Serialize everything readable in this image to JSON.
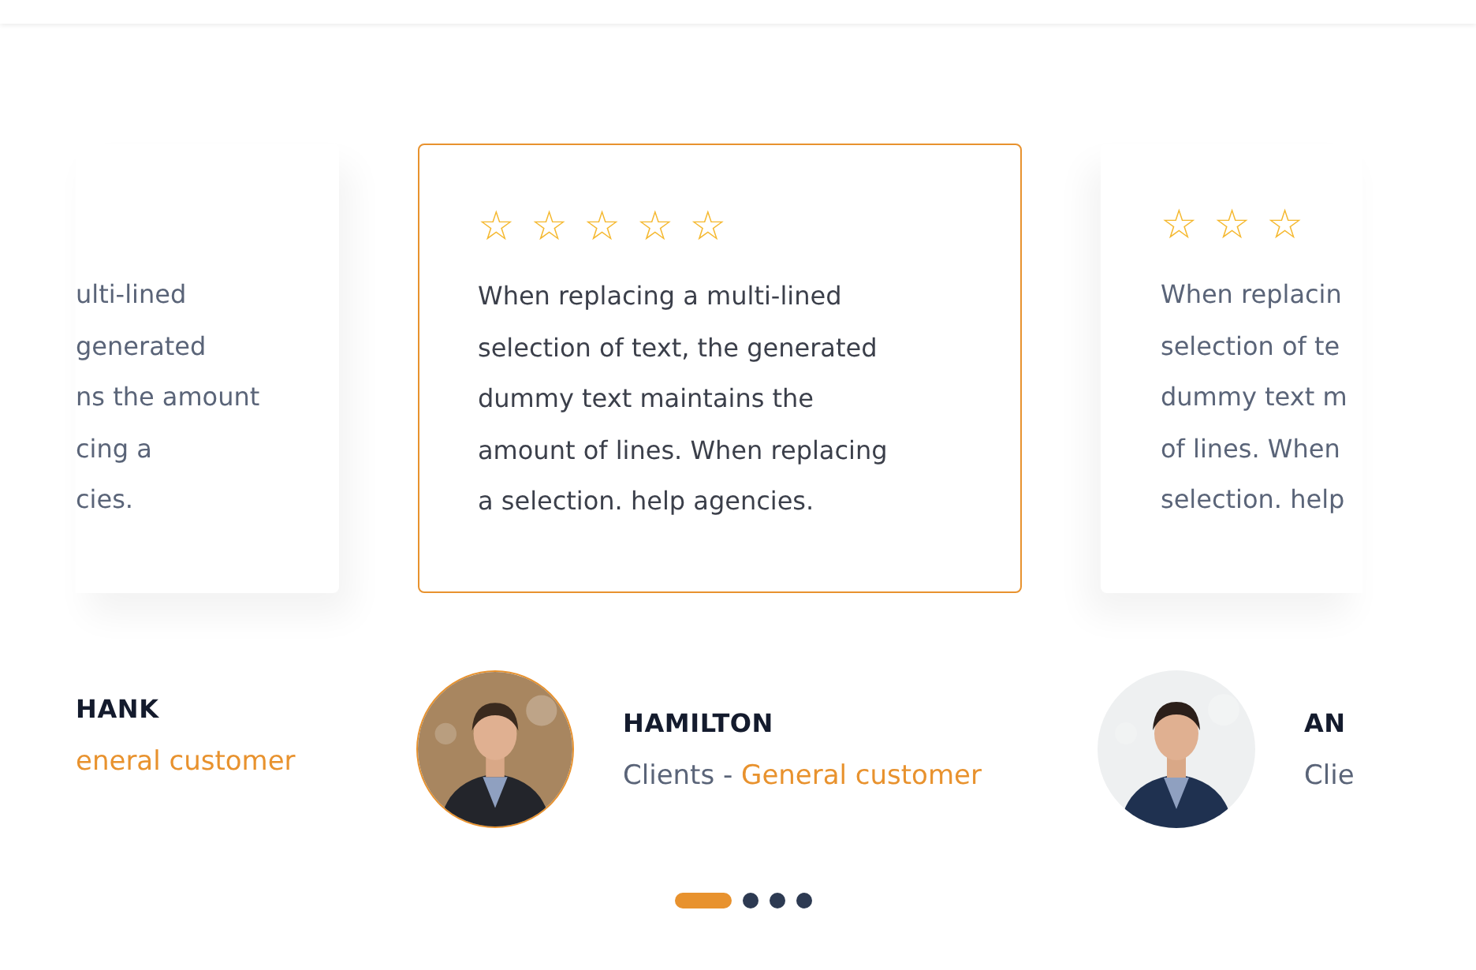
{
  "testimonials": [
    {
      "selected": false,
      "lines": [
        "ulti-lined",
        "generated",
        "ns the amount",
        "cing a",
        "cies."
      ],
      "name": "HANK",
      "role": "eneral customer"
    },
    {
      "selected": true,
      "rating": "☆ ☆ ☆ ☆ ☆",
      "lines": [
        "When replacing a multi-lined",
        "selection of text, the generated",
        "dummy text maintains the",
        "amount of lines. When replacing",
        "a selection. help agencies."
      ],
      "name": "HAMILTON",
      "role_prefix": "Clients - ",
      "role": "General customer"
    },
    {
      "selected": false,
      "rating": "☆ ☆ ☆",
      "lines": [
        "When replacin",
        "selection of te",
        "dummy text m",
        "of lines. When",
        "selection. help"
      ],
      "name": "AN",
      "role_prefix": "Clie"
    }
  ],
  "pager": [
    {
      "selected": true
    },
    {
      "selected": false
    },
    {
      "selected": false
    },
    {
      "selected": false
    }
  ]
}
